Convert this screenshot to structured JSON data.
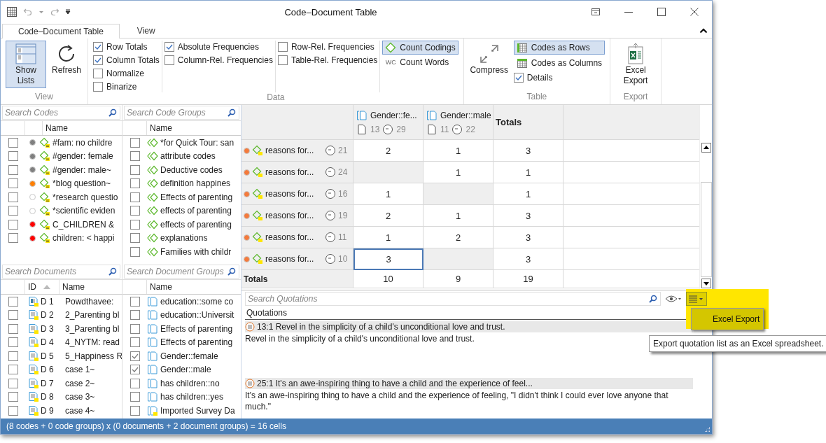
{
  "window": {
    "title": "Code–Document Table"
  },
  "ribbon": {
    "tabs": [
      {
        "label": "Code–Document Table",
        "selected": true
      },
      {
        "label": "View",
        "selected": false
      }
    ],
    "groups": [
      {
        "title": "View",
        "columns": [
          [
            {
              "kind": "large",
              "label": "Show Lists",
              "selected": true
            }
          ],
          [
            {
              "kind": "large",
              "label": "Refresh",
              "selected": false
            }
          ]
        ]
      },
      {
        "title": "Data",
        "columns": [
          [
            {
              "kind": "check",
              "label": "Row Totals",
              "checked": true
            },
            {
              "kind": "check",
              "label": "Column Totals",
              "checked": true
            },
            {
              "kind": "check",
              "label": "Normalize",
              "checked": false
            },
            {
              "kind": "check",
              "label": "Binarize",
              "checked": false
            }
          ],
          [
            {
              "kind": "check",
              "label": "Absolute Frequencies",
              "checked": true
            },
            {
              "kind": "check",
              "label": "Column-Rel. Frequencies",
              "checked": false
            }
          ],
          [
            {
              "kind": "check",
              "label": "Row-Rel. Frequencies",
              "checked": false
            },
            {
              "kind": "check",
              "label": "Table-Rel. Frequencies",
              "checked": false
            }
          ],
          [
            {
              "kind": "toggle",
              "label": "Count Codings",
              "selected": true
            },
            {
              "kind": "toggle",
              "label": "Count Words",
              "selected": false,
              "badge": "WC"
            }
          ]
        ]
      },
      {
        "title": "Table",
        "columns": [
          [
            {
              "kind": "large",
              "label": "Compress",
              "selected": false
            }
          ],
          [
            {
              "kind": "toggle",
              "label": "Codes as Rows",
              "selected": true
            },
            {
              "kind": "toggle",
              "label": "Codes as Columns",
              "selected": false
            },
            {
              "kind": "check",
              "label": "Details",
              "checked": true
            }
          ]
        ]
      },
      {
        "title": "Export",
        "columns": [
          [
            {
              "kind": "large",
              "label": "Excel Export",
              "selected": false
            }
          ]
        ]
      }
    ]
  },
  "codes": {
    "placeholder": "Search Codes",
    "columns": [
      "Name"
    ],
    "rows": [
      {
        "name": "#fam: no childre",
        "color": "#808080",
        "checked": false
      },
      {
        "name": "#gender: female",
        "color": "#808080",
        "checked": false
      },
      {
        "name": "#gender: male~",
        "color": "#808080",
        "checked": false
      },
      {
        "name": "*blog question~",
        "color": "#ff7f00",
        "checked": false
      },
      {
        "name": "*research questio",
        "color": "#ffffff",
        "checked": false
      },
      {
        "name": "*scientific eviden",
        "color": "#ffffff",
        "checked": false
      },
      {
        "name": "C_CHILDREN &",
        "color": "#ff0000",
        "checked": false
      },
      {
        "name": "children: < happi",
        "color": "#ff0000",
        "checked": false
      }
    ]
  },
  "code_groups": {
    "placeholder": "Search Code Groups",
    "columns": [
      "Name"
    ],
    "rows": [
      {
        "name": "*for Quick Tour: san",
        "checked": false
      },
      {
        "name": "attribute codes",
        "checked": false
      },
      {
        "name": "Deductive codes",
        "checked": false
      },
      {
        "name": "definition happines",
        "checked": false
      },
      {
        "name": "Effects of parenting",
        "checked": false
      },
      {
        "name": "effects of parenting",
        "checked": false
      },
      {
        "name": "effects of parenting",
        "checked": false
      },
      {
        "name": "explanations",
        "checked": false
      },
      {
        "name": "Families with childr",
        "checked": false
      }
    ]
  },
  "documents": {
    "placeholder": "Search Documents",
    "columns": [
      "ID",
      "Name"
    ],
    "rows": [
      {
        "id": "D 1",
        "name": "Powdthavee:",
        "checked": false
      },
      {
        "id": "D 2",
        "name": "2_Parenting bl",
        "checked": false
      },
      {
        "id": "D 3",
        "name": "3_Parenting bl",
        "checked": false
      },
      {
        "id": "D 4",
        "name": "4_NYTM: read",
        "checked": false
      },
      {
        "id": "D 5",
        "name": "5_Happiness R",
        "checked": false
      },
      {
        "id": "D 6",
        "name": "case 1~",
        "checked": false
      },
      {
        "id": "D 7",
        "name": "case 2~",
        "checked": false
      },
      {
        "id": "D 8",
        "name": "case 3~",
        "checked": false
      },
      {
        "id": "D 9",
        "name": "case 4~",
        "checked": false
      }
    ]
  },
  "document_groups": {
    "placeholder": "Search Document Groups",
    "columns": [
      "Name"
    ],
    "rows": [
      {
        "name": "education::some co",
        "checked": false
      },
      {
        "name": "education::Universit",
        "checked": false
      },
      {
        "name": "Effects of parenting",
        "checked": false
      },
      {
        "name": "Effects of parenting",
        "checked": false
      },
      {
        "name": "Gender::female",
        "checked": true
      },
      {
        "name": "Gender::male",
        "checked": true
      },
      {
        "name": "has children::no",
        "checked": false
      },
      {
        "name": "has children::yes",
        "checked": false
      },
      {
        "name": "Imported Survey Da",
        "checked": false
      }
    ]
  },
  "table": {
    "columns": [
      {
        "name": "Gender::fe...",
        "documents": "13",
        "quotations": "29"
      },
      {
        "name": "Gender::male",
        "documents": "11",
        "quotations": "22"
      }
    ],
    "totals_heading": "Totals",
    "rows": [
      {
        "name": "reasons for...",
        "count": "21",
        "color": "#f47a3c",
        "cells": [
          {
            "value": "2",
            "selected": false
          },
          {
            "value": "1",
            "selected": false
          }
        ],
        "total": "3"
      },
      {
        "name": "reasons for...",
        "count": "24",
        "color": "#f47a3c",
        "cells": [
          {
            "selected": false
          },
          {
            "value": "1",
            "selected": false
          }
        ],
        "total": "1"
      },
      {
        "name": "reasons for...",
        "count": "16",
        "color": "#f47a3c",
        "cells": [
          {
            "value": "1",
            "selected": false
          },
          {
            "selected": false
          }
        ],
        "total": "1"
      },
      {
        "name": "reasons for...",
        "count": "19",
        "color": "#f47a3c",
        "cells": [
          {
            "value": "2",
            "selected": false
          },
          {
            "value": "1",
            "selected": false
          }
        ],
        "total": "3"
      },
      {
        "name": "reasons for...",
        "count": "11",
        "color": "#f47a3c",
        "cells": [
          {
            "value": "1",
            "selected": false
          },
          {
            "value": "2",
            "selected": false
          }
        ],
        "total": "3"
      },
      {
        "name": "reasons for...",
        "count": "10",
        "color": "#f47a3c",
        "cells": [
          {
            "value": "3",
            "selected": true
          },
          {
            "selected": false
          }
        ],
        "total": "3"
      }
    ],
    "totals": {
      "label": "Totals",
      "values": [
        "10",
        "9"
      ],
      "total": "19"
    }
  },
  "quotations": {
    "placeholder": "Search Quotations",
    "heading": "Quotations",
    "list_button": {
      "selected": true
    },
    "menu": [
      "Excel Export"
    ],
    "tooltip": "Export quotation list as an Excel spreadsheet.",
    "items": [
      {
        "title": "13:1 Revel in the simplicity of a child's unconditional love and trust.",
        "text": "Revel in the simplicity of a child's unconditional love and trust."
      },
      {
        "title": "25:1 It's an awe-inspiring thing to have a child and the experience of feel...",
        "text": "It's an awe-inspiring thing to have a child and the experience of feeling, \"I didn't think I could ever love anyone that much.\""
      }
    ]
  },
  "status_bar": "(8 codes + 0 code groups) x (0 documents + 2 document groups) = 16 cells"
}
